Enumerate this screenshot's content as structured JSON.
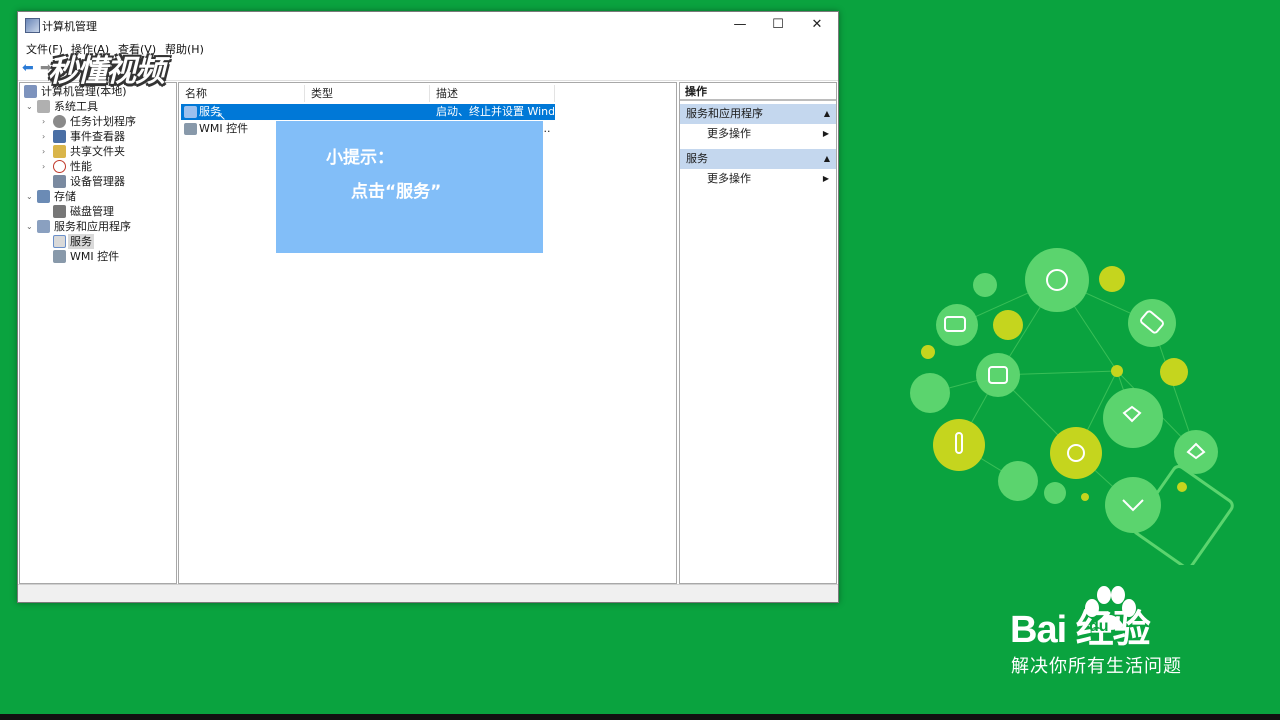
{
  "window": {
    "title": "计算机管理",
    "controls": {
      "minimize": "—",
      "maximize": "☐",
      "close": "✕"
    }
  },
  "menu": [
    "文件(F)",
    "操作(A)",
    "查看(V)",
    "帮助(H)"
  ],
  "overlay_logo": "秒懂视频",
  "tree": {
    "root": "计算机管理(本地)",
    "items": [
      {
        "label": "系统工具",
        "arrow": "⌄",
        "icon_color": "#b0b0b0"
      },
      {
        "label": "任务计划程序",
        "arrow": "›",
        "icon_color": "#8a8a8a"
      },
      {
        "label": "事件查看器",
        "arrow": "›",
        "icon_color": "#4a6fa5"
      },
      {
        "label": "共享文件夹",
        "arrow": "›",
        "icon_color": "#d9b54a"
      },
      {
        "label": "性能",
        "arrow": "›",
        "icon_color": "#c0392b"
      },
      {
        "label": "设备管理器",
        "arrow": "",
        "icon_color": "#7a8aa0"
      },
      {
        "label": "存储",
        "arrow": "⌄",
        "icon_color": "#6b8bb5"
      },
      {
        "label": "磁盘管理",
        "arrow": "",
        "icon_color": "#777777"
      },
      {
        "label": "服务和应用程序",
        "arrow": "⌄",
        "icon_color": "#8aa0c0"
      },
      {
        "label": "服务",
        "arrow": "",
        "icon_color": "#6a8fc9"
      },
      {
        "label": "WMI 控件",
        "arrow": "",
        "icon_color": "#8899aa"
      }
    ]
  },
  "list": {
    "columns": [
      "名称",
      "类型",
      "描述"
    ],
    "rows": [
      {
        "name": "服务",
        "type": "",
        "desc": "启动、终止并设置 Wind..."
      },
      {
        "name": "WMI 控件",
        "type": "",
        "desc": "..."
      }
    ]
  },
  "tip": {
    "line1": "小提示：",
    "line2": "点击“服务”"
  },
  "actions": {
    "header": "操作",
    "sections": [
      {
        "title": "服务和应用程序",
        "item": "更多操作"
      },
      {
        "title": "服务",
        "item": "更多操作"
      }
    ]
  },
  "brand": {
    "logo": "Bai  经验",
    "logo_du": "du",
    "tagline": "解决你所有生活问题"
  },
  "colors": {
    "background": "#0aa33f",
    "selection": "#0078d7",
    "tip": "#82bef8",
    "action_section": "#c4d7ee"
  }
}
